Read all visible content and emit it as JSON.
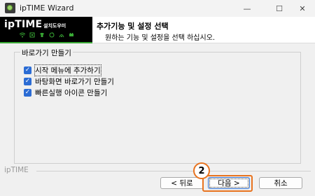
{
  "window": {
    "title": "ipTIME Wizard",
    "minimize_glyph": "—",
    "maximize_glyph": "☐",
    "close_glyph": "✕"
  },
  "logo": {
    "brand": "ipTIME",
    "subtitle": "설치도우미",
    "icons": [
      "wifi-icon",
      "lan-icon",
      "tshirt-icon",
      "sync-icon",
      "signal-icon",
      "storage-icon"
    ]
  },
  "header": {
    "title": "추가기능 및 설정 선택",
    "subtitle": "원하는 기능 및 설정을 선택 하십시오."
  },
  "group": {
    "legend": "바로가기 만들기",
    "options": [
      {
        "label": "시작 메뉴에 추가하기",
        "checked": true
      },
      {
        "label": "바탕화면 바로가기 만들기",
        "checked": true
      },
      {
        "label": "빠른실행 아이콘 만들기",
        "checked": true
      }
    ]
  },
  "footer": {
    "brand": "ipTIME",
    "back_label": "< 뒤로",
    "next_label": "다음 >",
    "cancel_label": "취소"
  },
  "annotation": {
    "step_number": "2",
    "accent_color": "#e8731f"
  },
  "colors": {
    "brand_green": "#39a935",
    "checkbox_blue": "#2b6cd4"
  }
}
